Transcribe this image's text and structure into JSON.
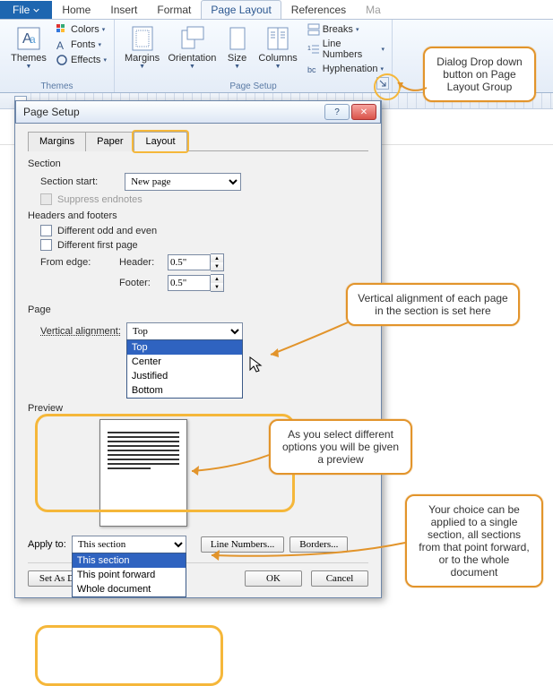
{
  "ribbon": {
    "file": "File",
    "tabs": [
      "Home",
      "Insert",
      "Format",
      "Page Layout",
      "References",
      "Ma"
    ],
    "active_index": 3,
    "themes": {
      "label": "Themes",
      "big": "Themes",
      "colors": "Colors",
      "fonts": "Fonts",
      "effects": "Effects"
    },
    "page_setup": {
      "label": "Page Setup",
      "margins": "Margins",
      "orientation": "Orientation",
      "size": "Size",
      "columns": "Columns",
      "breaks": "Breaks",
      "line_numbers": "Line Numbers",
      "hyphenation": "Hyphenation"
    }
  },
  "dialog": {
    "title": "Page Setup",
    "tabs": [
      "Margins",
      "Paper",
      "Layout"
    ],
    "active_index": 2,
    "section_heading": "Section",
    "section_start_label": "Section start:",
    "section_start_value": "New page",
    "suppress_endnotes": "Suppress endnotes",
    "hf_heading": "Headers and footers",
    "diff_odd_even": "Different odd and even",
    "diff_first": "Different first page",
    "from_edge": "From edge:",
    "header_label": "Header:",
    "header_value": "0.5\"",
    "footer_label": "Footer:",
    "footer_value": "0.5\"",
    "page_heading": "Page",
    "valign_label": "Vertical alignment:",
    "valign_value": "Top",
    "valign_options": [
      "Top",
      "Center",
      "Justified",
      "Bottom"
    ],
    "preview_heading": "Preview",
    "apply_to_label": "Apply to:",
    "apply_to_value": "This section",
    "apply_to_options": [
      "This section",
      "This point forward",
      "Whole document"
    ],
    "line_numbers_btn": "Line Numbers...",
    "borders_btn": "Borders...",
    "set_default_btn": "Set As Default",
    "ok": "OK",
    "cancel": "Cancel"
  },
  "callouts": {
    "c1": "Dialog Drop down button on Page Layout Group",
    "c2": "Vertical alignment of each page in the section is set here",
    "c3": "As you select different options you will be given a preview",
    "c4": "Your choice can be applied to a single section, all sections from that point forward, or to the whole document"
  }
}
